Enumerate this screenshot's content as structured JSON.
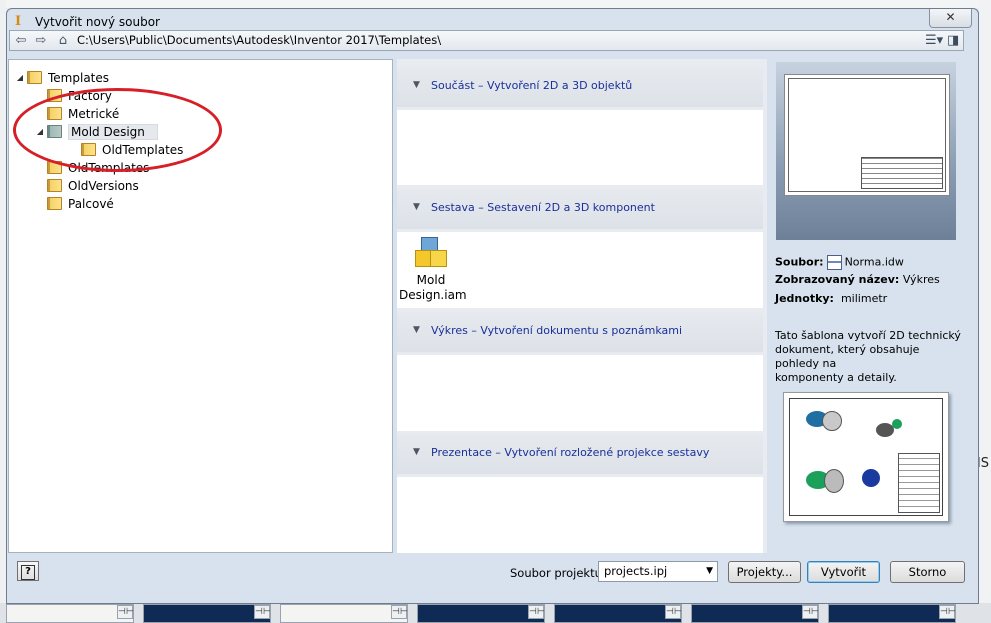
{
  "dialog": {
    "title": "Vytvořit nový soubor",
    "close_label": "✕"
  },
  "addressbar": {
    "path": "C:\\Users\\Public\\Documents\\Autodesk\\Inventor 2017\\Templates\\",
    "back_icon": "back-arrow-icon",
    "forward_icon": "forward-arrow-icon",
    "home_icon": "home-icon"
  },
  "tree": {
    "items": [
      {
        "label": "Templates",
        "expanded": true
      },
      {
        "label": "Factory"
      },
      {
        "label": "Metrické"
      },
      {
        "label": "Mold Design",
        "expanded": true,
        "selected": true
      },
      {
        "label": "OldTemplates"
      },
      {
        "label": "OldTemplates"
      },
      {
        "label": "OldVersions"
      },
      {
        "label": "Palcové"
      }
    ]
  },
  "categories": [
    {
      "label": "Součást – Vytvoření 2D a 3D objektů",
      "files": []
    },
    {
      "label": "Sestava – Sestavení 2D a 3D komponent",
      "files": [
        {
          "line1": "Mold",
          "line2": "Design.iam"
        }
      ]
    },
    {
      "label": "Výkres – Vytvoření dokumentu s poznámkami",
      "files": []
    },
    {
      "label": "Prezentace – Vytvoření rozložené projekce sestavy",
      "files": []
    }
  ],
  "preview": {
    "file_label": "Soubor:",
    "file_value": "Norma.idw",
    "display_name_label": "Zobrazovaný název:",
    "display_name_value": "Výkres",
    "units_label": "Jednotky:",
    "units_value": "milimetr",
    "description_line1": "Tato šablona vytvoří 2D technický",
    "description_line2": "dokument, který obsahuje pohledy na",
    "description_line3": "komponenty a detaily."
  },
  "footer": {
    "help_label": "?",
    "project_label": "Soubor projektu:",
    "project_value": "projects.ipj",
    "projects_button": "Projekty...",
    "create_button": "Vytvořit",
    "cancel_button": "Storno"
  },
  "background": {
    "right_edge_text": "IS",
    "pin_glyph": "⊣⊢"
  },
  "colors": {
    "category_link": "#1a2f99",
    "annotation_ellipse": "#d61f26",
    "dialog_frame": "#d8e2ee"
  }
}
